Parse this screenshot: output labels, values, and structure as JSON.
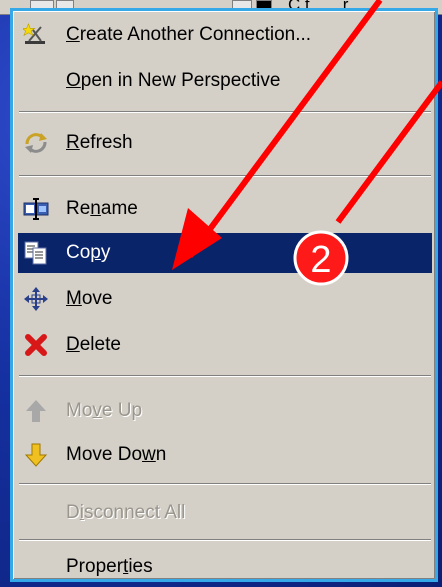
{
  "toolbar": {
    "text": "C t ... , r ,"
  },
  "menu": {
    "items": [
      {
        "name": "create-another-connection",
        "pre": "",
        "ul": "C",
        "post": "reate Another Connection...",
        "icon": "new-connection-icon"
      },
      {
        "name": "open-in-new-perspective",
        "pre": "",
        "ul": "O",
        "post": "pen in New Perspective",
        "icon": ""
      },
      {
        "name": "refresh",
        "pre": "",
        "ul": "R",
        "post": "efresh",
        "icon": "refresh-icon"
      },
      {
        "name": "rename",
        "pre": "Re",
        "ul": "n",
        "post": "ame",
        "icon": "rename-icon"
      },
      {
        "name": "copy",
        "pre": "Co",
        "ul": "p",
        "post": "y",
        "icon": "copy-icon"
      },
      {
        "name": "move",
        "pre": "",
        "ul": "M",
        "post": "ove",
        "icon": "move-icon"
      },
      {
        "name": "delete",
        "pre": "",
        "ul": "D",
        "post": "elete",
        "icon": "delete-icon"
      },
      {
        "name": "move-up",
        "pre": "Mo",
        "ul": "v",
        "post": "e Up",
        "icon": "arrow-up-icon"
      },
      {
        "name": "move-down",
        "pre": "Move Do",
        "ul": "w",
        "post": "n",
        "icon": "arrow-down-icon"
      },
      {
        "name": "disconnect-all",
        "pre": "D",
        "ul": "i",
        "post": "sconnect All",
        "icon": ""
      },
      {
        "name": "properties",
        "pre": "Proper",
        "ul": "t",
        "post": "ies",
        "icon": ""
      }
    ]
  },
  "annotation": {
    "badge_number": "2"
  }
}
